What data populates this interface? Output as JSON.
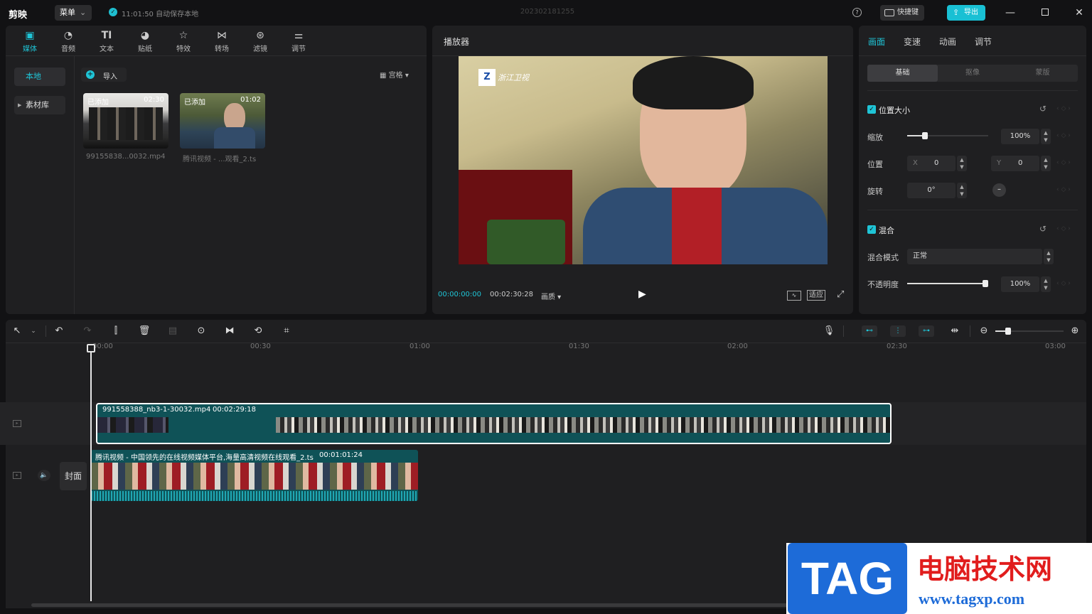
{
  "app": {
    "name": "剪映",
    "menu_label": "菜单",
    "autosave": "11:01:50 自动保存本地",
    "project_title": "202302181255",
    "help_glyph": "?",
    "shortcut_label": "快捷键",
    "export_label": "导出"
  },
  "media_tools": [
    {
      "label": "媒体",
      "icon": "media-icon"
    },
    {
      "label": "音频",
      "icon": "audio-icon"
    },
    {
      "label": "文本",
      "icon": "text-icon"
    },
    {
      "label": "贴纸",
      "icon": "sticker-icon"
    },
    {
      "label": "特效",
      "icon": "effects-icon"
    },
    {
      "label": "转场",
      "icon": "transition-icon"
    },
    {
      "label": "滤镜",
      "icon": "filter-icon"
    },
    {
      "label": "调节",
      "icon": "adjust-icon"
    }
  ],
  "media_panel": {
    "local_label": "本地",
    "library_label": "素材库",
    "import_label": "导入",
    "view_label": "宫格",
    "items": [
      {
        "tag": "已添加",
        "duration": "02:30",
        "name": "99155838...0032.mp4"
      },
      {
        "tag": "已添加",
        "duration": "01:02",
        "name": "腾讯视频 - ...观看_2.ts"
      }
    ]
  },
  "player": {
    "title": "播放器",
    "current_time": "00:00:00:00",
    "total_time": "00:02:30:28",
    "quality_label": "画质",
    "fit_label": "适应",
    "channel_logo_text": "浙江卫视"
  },
  "inspector": {
    "tabs": [
      "画面",
      "变速",
      "动画",
      "调节"
    ],
    "segments": [
      "基础",
      "抠像",
      "蒙版"
    ],
    "position_size": {
      "title": "位置大小",
      "scale_label": "缩放",
      "scale_value": "100%",
      "scale_fraction": 0.2,
      "position_label": "位置",
      "x_label": "X",
      "x_value": "0",
      "y_label": "Y",
      "y_value": "0",
      "rotation_label": "旋转",
      "rotation_value": "0°"
    },
    "blend": {
      "title": "混合",
      "mode_label": "混合模式",
      "mode_value": "正常",
      "opacity_label": "不透明度",
      "opacity_value": "100%",
      "opacity_fraction": 1.0
    }
  },
  "timeline": {
    "ruler": [
      "00:00",
      "00:30",
      "01:00",
      "01:30",
      "02:00",
      "02:30",
      "03:00"
    ],
    "clip1": {
      "name": "991558388_nb3-1-30032.mp4",
      "duration": "00:02:29:18"
    },
    "clip2": {
      "name": "腾讯视频 - 中国领先的在线视频媒体平台,海量高清视频在线观看_2.ts",
      "duration": "00:01:01:24"
    },
    "cover_label": "封面"
  },
  "watermark": {
    "tag": "TAG",
    "site_name": "电脑技术网",
    "url": "www.tagxp.com"
  }
}
